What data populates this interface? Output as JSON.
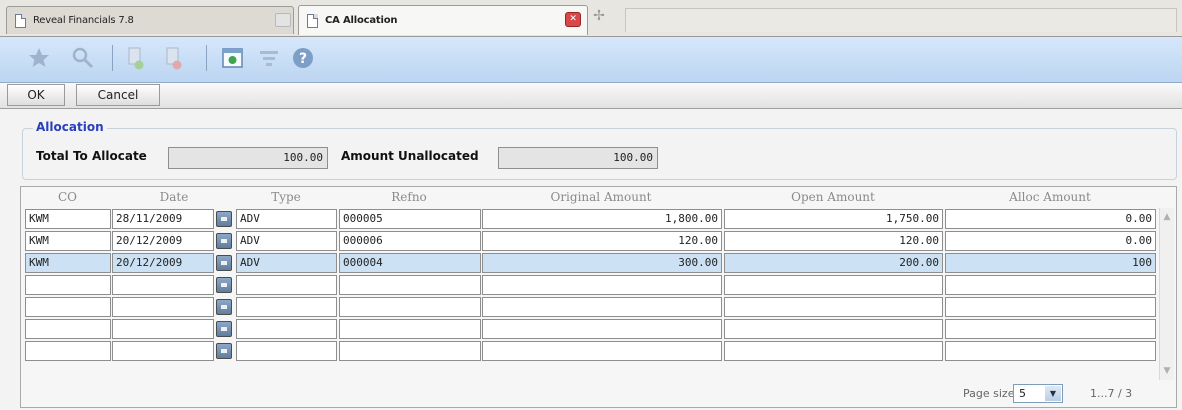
{
  "tabs": [
    {
      "title": "Reveal Financials 7.8",
      "active": false
    },
    {
      "title": "CA Allocation",
      "active": true
    }
  ],
  "toolbar": {
    "icons": [
      "favorite-icon",
      "search-icon",
      "add-document-icon",
      "remove-document-icon",
      "refresh-icon",
      "filter-icon",
      "help-icon"
    ]
  },
  "actions": {
    "ok": "OK",
    "cancel": "Cancel"
  },
  "allocation": {
    "title": "Allocation",
    "total_label": "Total To Allocate",
    "total_value": "100.00",
    "unallocated_label": "Amount Unallocated",
    "unallocated_value": "100.00"
  },
  "grid": {
    "columns": [
      "CO",
      "Date",
      "Type",
      "Refno",
      "Original Amount",
      "Open Amount",
      "Alloc Amount"
    ],
    "rows": [
      {
        "co": "KWM",
        "date": "28/11/2009",
        "type": "ADV",
        "refno": "000005",
        "original": "1,800.00",
        "open": "1,750.00",
        "alloc": "0.00",
        "selected": false
      },
      {
        "co": "KWM",
        "date": "20/12/2009",
        "type": "ADV",
        "refno": "000006",
        "original": "120.00",
        "open": "120.00",
        "alloc": "0.00",
        "selected": false
      },
      {
        "co": "KWM",
        "date": "20/12/2009",
        "type": "ADV",
        "refno": "000004",
        "original": "300.00",
        "open": "200.00",
        "alloc": "100",
        "selected": true
      },
      {
        "co": "",
        "date": "",
        "type": "",
        "refno": "",
        "original": "",
        "open": "",
        "alloc": "",
        "selected": false
      },
      {
        "co": "",
        "date": "",
        "type": "",
        "refno": "",
        "original": "",
        "open": "",
        "alloc": "",
        "selected": false
      },
      {
        "co": "",
        "date": "",
        "type": "",
        "refno": "",
        "original": "",
        "open": "",
        "alloc": "",
        "selected": false
      },
      {
        "co": "",
        "date": "",
        "type": "",
        "refno": "",
        "original": "",
        "open": "",
        "alloc": "",
        "selected": false
      }
    ]
  },
  "pager": {
    "label": "Page size:",
    "size": "5",
    "info": "1...7 / 3"
  },
  "colors": {
    "toolbar": "#c6dcf5",
    "selected_row": "#cce2f4",
    "group_title": "#2a3fbd"
  }
}
